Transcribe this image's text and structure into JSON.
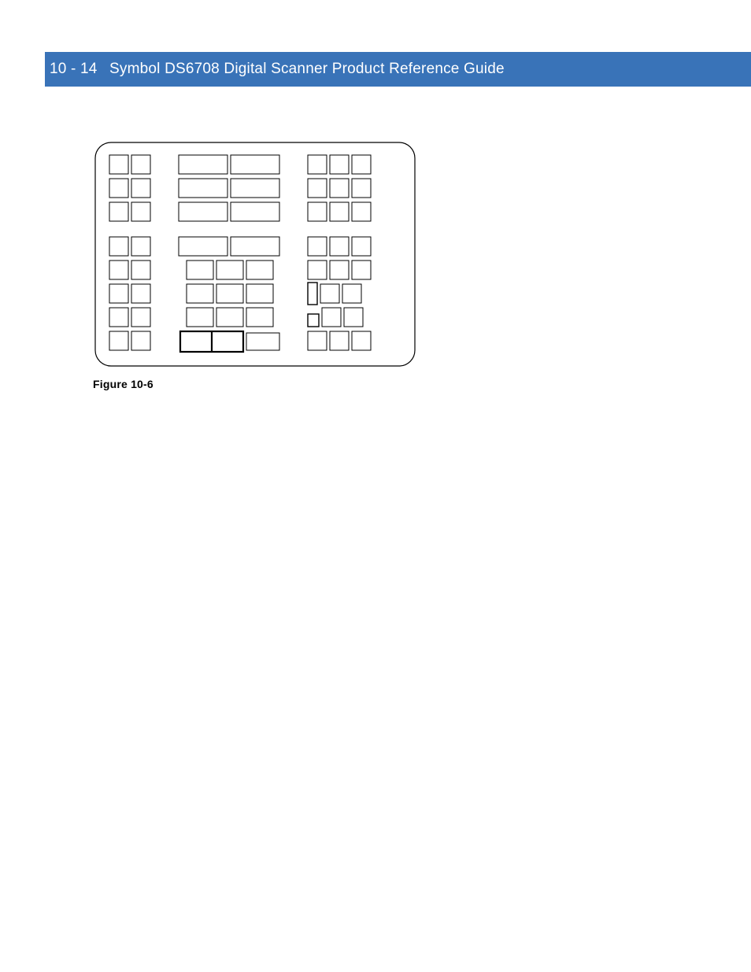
{
  "header": {
    "page_number": "10 - 14",
    "title": "Symbol DS6708 Digital Scanner Product Reference Guide"
  },
  "figure": {
    "caption": "Figure 10-6"
  }
}
